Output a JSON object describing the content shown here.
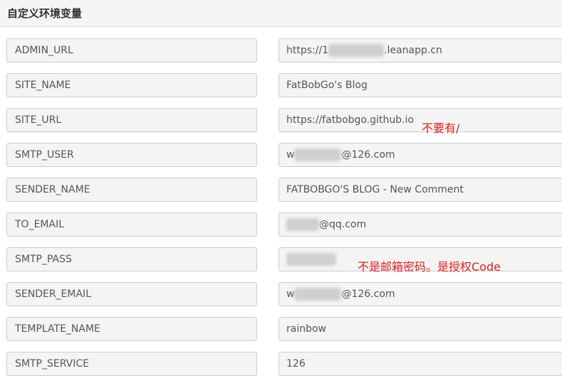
{
  "panel": {
    "title": "自定义环境变量"
  },
  "rows": [
    {
      "key": "ADMIN_URL",
      "value_prefix": "https://1",
      "value_suffix": ".leanapp.cn"
    },
    {
      "key": "SITE_NAME",
      "value": "FatBobGo's Blog"
    },
    {
      "key": "SITE_URL",
      "value": "https://fatbobgo.github.io"
    },
    {
      "key": "SMTP_USER",
      "value_prefix": "w",
      "value_suffix": "@126.com"
    },
    {
      "key": "SENDER_NAME",
      "value": "FATBOBGO'S BLOG - New Comment"
    },
    {
      "key": "TO_EMAIL",
      "value_prefix": "",
      "value_suffix": "@qq.com"
    },
    {
      "key": "SMTP_PASS",
      "value_prefix": "",
      "value_suffix": ""
    },
    {
      "key": "SENDER_EMAIL",
      "value_prefix": "w",
      "value_suffix": "@126.com"
    },
    {
      "key": "TEMPLATE_NAME",
      "value": "rainbow"
    },
    {
      "key": "SMTP_SERVICE",
      "value": "126"
    }
  ],
  "annotations": {
    "site_url_note": "不要有/",
    "smtp_pass_note": "不是邮箱密码。是授权Code"
  },
  "colors": {
    "annotation": "#e02020",
    "field_bg": "#f4f4f4",
    "border": "#cccccc"
  }
}
